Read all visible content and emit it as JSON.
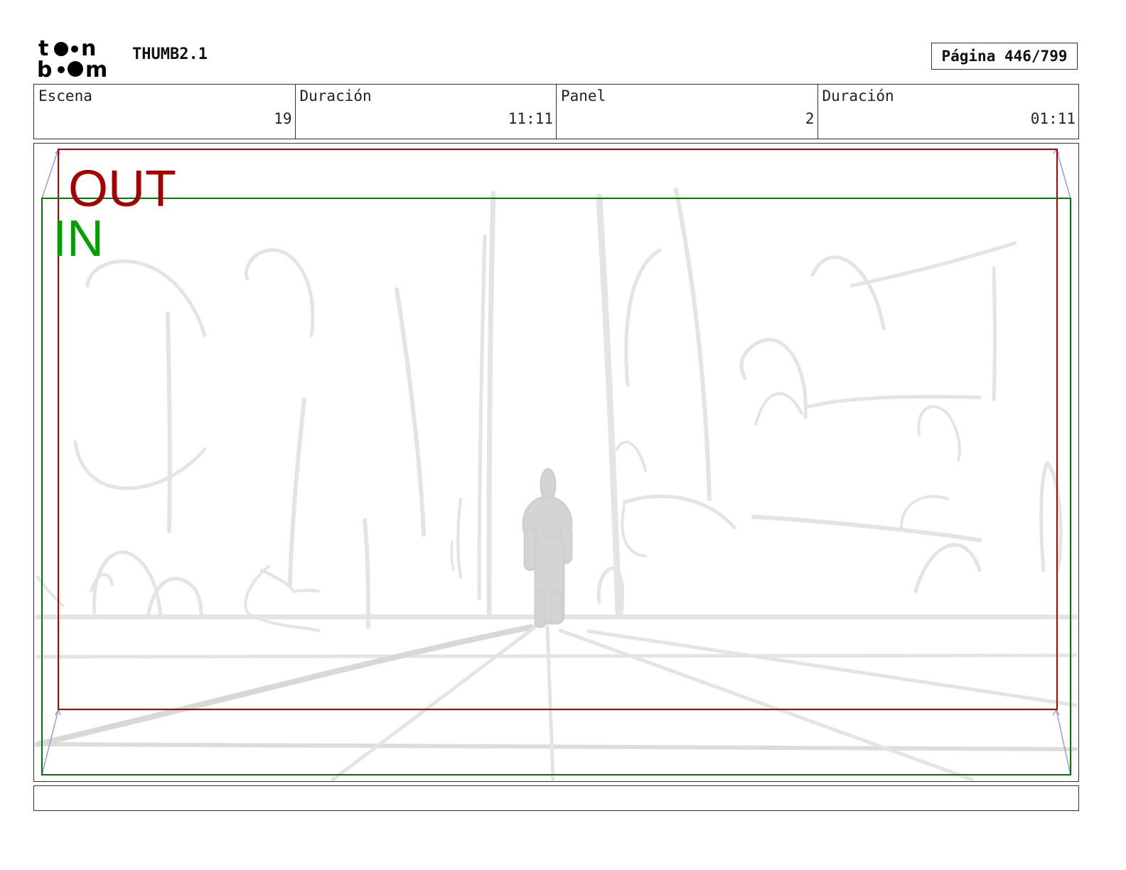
{
  "header": {
    "logo_text_top": "t••n",
    "logo_text_bottom": "b••m",
    "project_title": "THUMB2.1",
    "page_label": "Página 446/799"
  },
  "info": {
    "scene_label": "Escena",
    "scene_value": "19",
    "scene_duration_label": "Duración",
    "scene_duration_value": "11:11",
    "panel_label": "Panel",
    "panel_value": "2",
    "panel_duration_label": "Duración",
    "panel_duration_value": "01:11"
  },
  "panel": {
    "out_label": "OUT",
    "in_label": "IN",
    "out_color": "#a50000",
    "in_color": "#00a000",
    "camera_arrow_color": "#9a9ad8"
  },
  "caption": {
    "text": ""
  }
}
